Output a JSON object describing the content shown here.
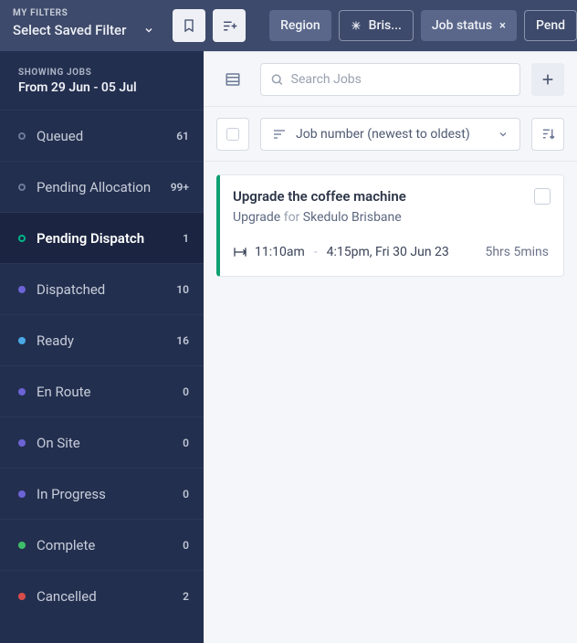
{
  "topbar": {
    "my_filters_label": "MY FILTERS",
    "saved_filter_text": "Select Saved Filter",
    "chips": {
      "region": "Region",
      "bris": "Bris...",
      "job_status": "Job status",
      "x": "×",
      "pend": "Pend"
    }
  },
  "sidebar": {
    "showing_label": "SHOWING JOBS",
    "date_range": "From 29 Jun - 05 Jul",
    "statuses": [
      {
        "label": "Queued",
        "count": "61",
        "dotColor": "#6d7a97",
        "ring": true,
        "active": false
      },
      {
        "label": "Pending Allocation",
        "count": "99+",
        "dotColor": "#6d7a97",
        "ring": true,
        "active": false
      },
      {
        "label": "Pending Dispatch",
        "count": "1",
        "dotColor": "#00b48a",
        "ring": true,
        "active": true
      },
      {
        "label": "Dispatched",
        "count": "10",
        "dotColor": "#6c63d6",
        "ring": false,
        "active": false
      },
      {
        "label": "Ready",
        "count": "16",
        "dotColor": "#4aa9e6",
        "ring": false,
        "active": false
      },
      {
        "label": "En Route",
        "count": "0",
        "dotColor": "#6c63d6",
        "ring": false,
        "active": false
      },
      {
        "label": "On Site",
        "count": "0",
        "dotColor": "#6c63d6",
        "ring": false,
        "active": false
      },
      {
        "label": "In Progress",
        "count": "0",
        "dotColor": "#6c63d6",
        "ring": false,
        "active": false
      },
      {
        "label": "Complete",
        "count": "0",
        "dotColor": "#3fbf6a",
        "ring": false,
        "active": false
      },
      {
        "label": "Cancelled",
        "count": "2",
        "dotColor": "#d94c4c",
        "ring": false,
        "active": false
      }
    ]
  },
  "main": {
    "search_placeholder": "Search Jobs",
    "sort_label": "Job number (newest to oldest)"
  },
  "job": {
    "title": "Upgrade the coffee machine",
    "type": "Upgrade",
    "for_word": "for",
    "account": "Skedulo Brisbane",
    "start_time": "11:10am",
    "dash": "-",
    "end_time": "4:15pm, Fri 30 Jun 23",
    "duration": "5hrs 5mins"
  }
}
